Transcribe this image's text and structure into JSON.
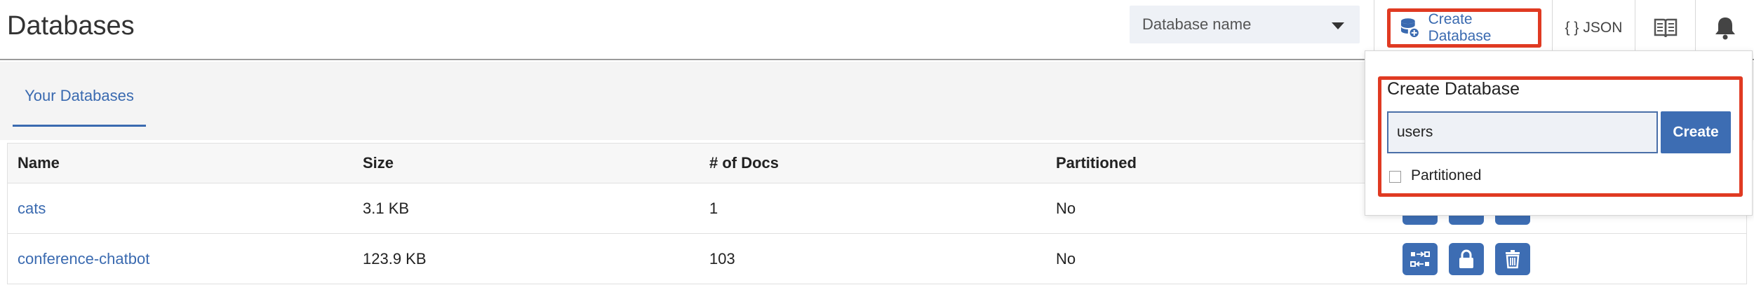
{
  "header": {
    "title": "Databases",
    "db_select_placeholder": "Database name",
    "create_db_label": "Create Database",
    "json_label": "JSON",
    "json_braces": "{ }",
    "icons": {
      "create_db": "database-add-icon",
      "docs": "book-icon",
      "notifications": "bell-icon",
      "select": "chevron-down-icon"
    }
  },
  "tabs": [
    {
      "label": "Your Databases",
      "active": true
    }
  ],
  "table": {
    "columns": [
      "Name",
      "Size",
      "# of Docs",
      "Partitioned"
    ],
    "rows": [
      {
        "name": "cats",
        "size": "3.1 KB",
        "docs": "1",
        "partitioned": "No"
      },
      {
        "name": "conference-chatbot",
        "size": "123.9 KB",
        "docs": "103",
        "partitioned": "No"
      }
    ],
    "action_icons": [
      "replicate-icon",
      "lock-icon",
      "trash-icon"
    ]
  },
  "popover": {
    "title": "Create Database",
    "input_value": "users",
    "create_label": "Create",
    "partitioned_label": "Partitioned",
    "partitioned_checked": false
  },
  "colors": {
    "accent": "#3d6db3",
    "highlight": "#e03a22",
    "link": "#3a6ab0"
  }
}
